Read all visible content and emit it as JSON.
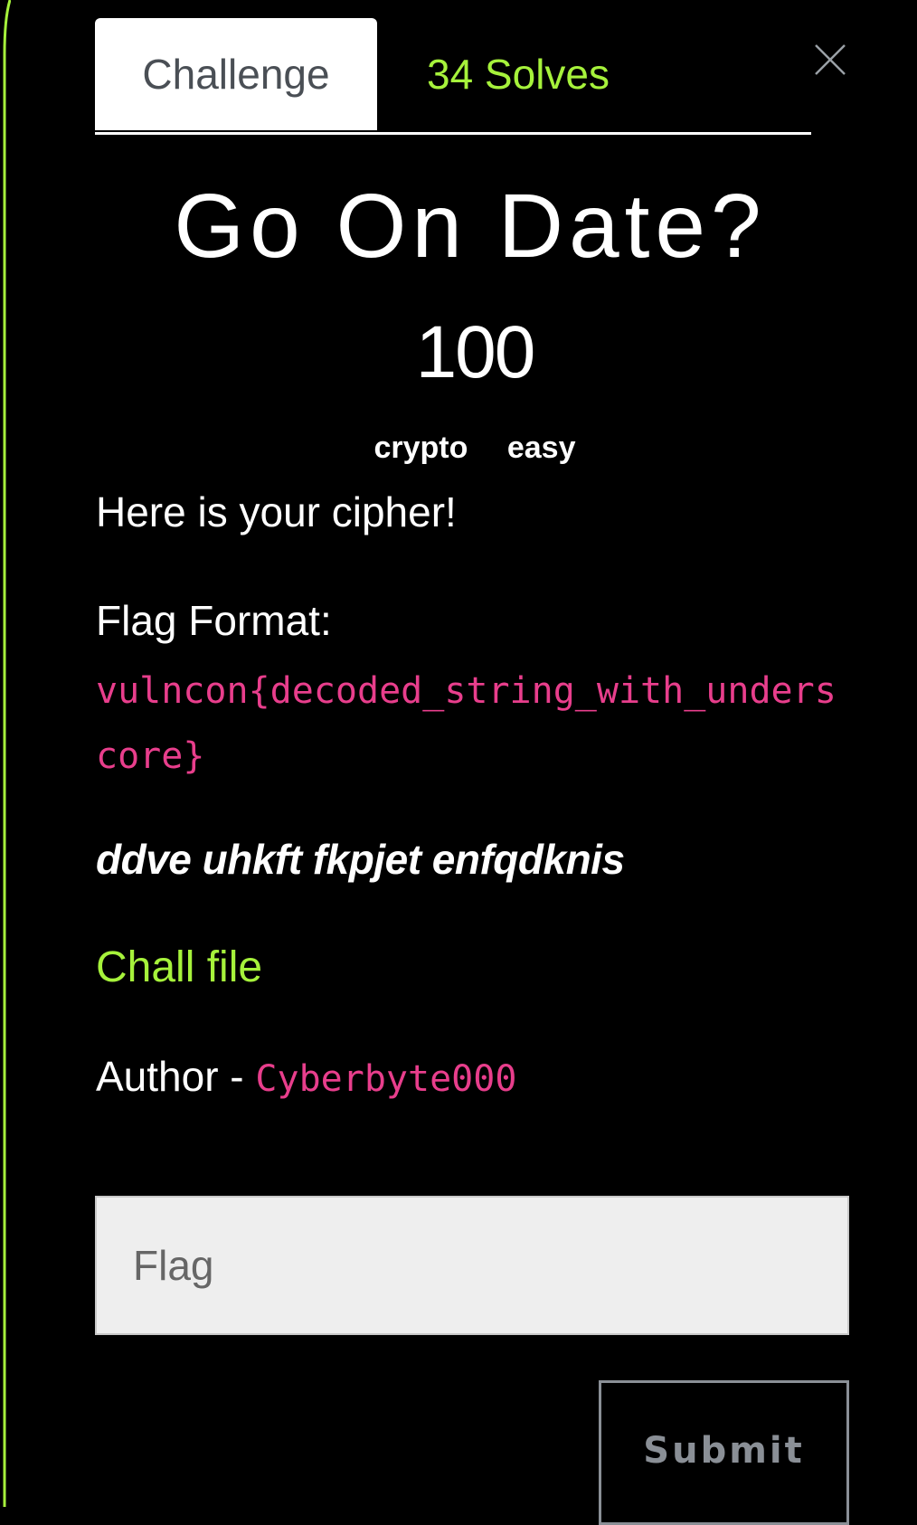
{
  "tabs": {
    "challenge_label": "Challenge",
    "solves_label": "34 Solves"
  },
  "challenge": {
    "title": "Go On Date?",
    "points": "100",
    "tags": [
      "crypto",
      "easy"
    ],
    "intro": "Here is your cipher!",
    "flag_format_label": "Flag Format:",
    "flag_format": "vulncon{decoded_string_with_underscore}",
    "cipher_text": "ddve uhkft fkpjet enfqdknis",
    "file_link": "Chall file",
    "author_label": "Author -",
    "author_handle": "Cyberbyte000"
  },
  "form": {
    "flag_placeholder": "Flag",
    "submit_label": "Submit"
  },
  "icons": {
    "close": "close-icon"
  },
  "colors": {
    "background": "#000000",
    "accent_green": "#a6f23b",
    "code_pink": "#e83e8c",
    "button_gray": "#8a8f96"
  }
}
